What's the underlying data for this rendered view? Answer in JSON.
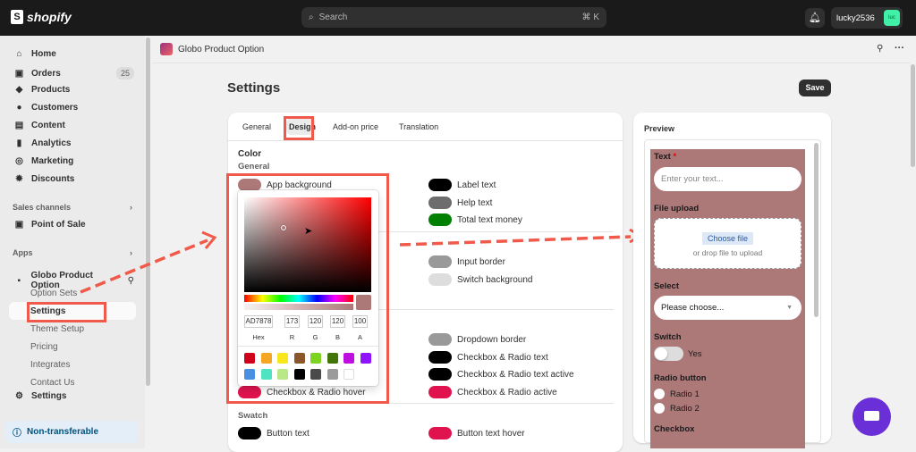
{
  "topbar": {
    "brand": "shopify",
    "search_placeholder": "Search",
    "shortcut": "⌘ K",
    "username": "lucky2536",
    "avatar_initials": "luc"
  },
  "sidebar": {
    "items": [
      {
        "label": "Home",
        "icon": "home-icon"
      },
      {
        "label": "Orders",
        "icon": "inbox-icon",
        "badge": "25"
      },
      {
        "label": "Products",
        "icon": "tag-icon"
      },
      {
        "label": "Customers",
        "icon": "person-icon"
      },
      {
        "label": "Content",
        "icon": "image-icon"
      },
      {
        "label": "Analytics",
        "icon": "bar-chart-icon"
      },
      {
        "label": "Marketing",
        "icon": "target-icon"
      },
      {
        "label": "Discounts",
        "icon": "discount-icon"
      }
    ],
    "sales_channels": "Sales channels",
    "point_of_sale": "Point of Sale",
    "apps": "Apps",
    "app_name": "Globo Product Option",
    "app_subitems": [
      "Option Sets",
      "Settings",
      "Theme Setup",
      "Pricing",
      "Integrates",
      "Contact Us"
    ],
    "settings": "Settings",
    "non_transferable": "Non-transferable"
  },
  "app_header": {
    "title": "Globo Product Option"
  },
  "page": {
    "title": "Settings",
    "save": "Save"
  },
  "tabs": [
    "General",
    "Design",
    "Add-on price",
    "Translation"
  ],
  "design": {
    "color_heading": "Color",
    "general_heading": "General",
    "swatch_heading": "Swatch",
    "left_rows": [
      {
        "label": "App background",
        "color": "#ad7878"
      },
      {
        "label": "Checkbox & Radio hover",
        "color": "#e0134f"
      }
    ],
    "right_rows": [
      {
        "label": "Label text",
        "color": "#000000"
      },
      {
        "label": "Help text",
        "color": "#6d6d6d"
      },
      {
        "label": "Total text money",
        "color": "#008000"
      },
      {
        "label": "Input border",
        "color": "#999999"
      },
      {
        "label": "Switch background",
        "color": "#dddddd"
      },
      {
        "label": "Dropdown border",
        "color": "#999999"
      },
      {
        "label": "Checkbox & Radio text",
        "color": "#000000"
      },
      {
        "label": "Checkbox & Radio text active",
        "color": "#000000"
      },
      {
        "label": "Checkbox & Radio active",
        "color": "#e0134f"
      }
    ],
    "swatch_rows": [
      {
        "label": "Button text",
        "color": "#000000"
      },
      {
        "label": "Button text hover",
        "color": "#e0134f"
      }
    ]
  },
  "picker": {
    "hex": "AD7878",
    "r": "173",
    "g": "120",
    "b": "120",
    "a": "100",
    "labels": [
      "Hex",
      "R",
      "G",
      "B",
      "A"
    ],
    "presets": [
      "#d0021b",
      "#f5a623",
      "#f8e71c",
      "#8b572a",
      "#7ed321",
      "#417505",
      "#bd10e0",
      "#9013fe",
      "#4a90e2",
      "#50e3c2",
      "#b8e986",
      "#000000",
      "#4a4a4a",
      "#9b9b9b",
      "#ffffff"
    ]
  },
  "preview": {
    "title": "Preview",
    "text_label": "Text",
    "required": "*",
    "text_placeholder": "Enter your text...",
    "file_label": "File upload",
    "choose_file": "Choose file",
    "drop_text": "or drop file to upload",
    "select_label": "Select",
    "select_value": "Please choose...",
    "switch_label": "Switch",
    "switch_value": "Yes",
    "radio_label": "Radio button",
    "radios": [
      "Radio 1",
      "Radio 2"
    ],
    "checkbox_label": "Checkbox"
  }
}
